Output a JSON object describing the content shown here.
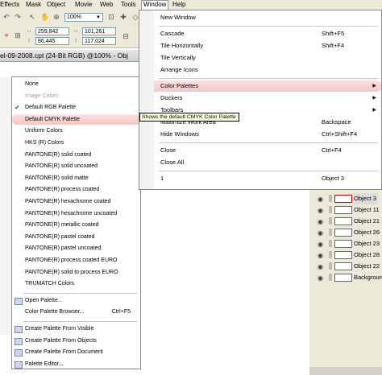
{
  "menubar": {
    "items": [
      "Effects",
      "Mask",
      "Object",
      "Movie",
      "Web",
      "Tools",
      "Window",
      "Help"
    ]
  },
  "toolbar": {
    "zoom": "100%",
    "x": "259,842",
    "y": "86,445",
    "w": "101,261",
    "h": "117,024"
  },
  "document": {
    "title": "el-09-2008.cpt (24-Bit RGB) @100% - Obj"
  },
  "window_menu": {
    "items": [
      {
        "label": "New Window",
        "shortcut": "",
        "icon": "new-window-icon"
      },
      {
        "separator": true
      },
      {
        "label": "Cascade",
        "shortcut": "Shift+F5",
        "icon": "cascade-icon"
      },
      {
        "label": "Tile Horizontally",
        "shortcut": "Shift+F4",
        "icon": "tile-horizontal-icon"
      },
      {
        "label": "Tile Vertically",
        "shortcut": "",
        "icon": "tile-vertical-icon"
      },
      {
        "label": "Arrange Icons",
        "shortcut": "",
        "icon": "arrange-icons-icon"
      },
      {
        "separator": true
      },
      {
        "label": "Color Palettes",
        "shortcut": "",
        "submenu": true,
        "highlighted": true
      },
      {
        "label": "Dockers",
        "shortcut": "",
        "submenu": true
      },
      {
        "label": "Toolbars",
        "shortcut": "",
        "submenu": true
      },
      {
        "label": "Maximize Work Area",
        "shortcut": "Backspace",
        "icon": "maximize-icon"
      },
      {
        "label": "Hide Windows",
        "shortcut": "Ctrl+Shift+F4",
        "icon": "hide-windows-icon"
      },
      {
        "separator": true
      },
      {
        "label": "Close",
        "shortcut": "Ctrl+F4",
        "icon": "close-window-icon"
      },
      {
        "label": "Close All",
        "shortcut": ""
      },
      {
        "separator": true
      },
      {
        "label": "1",
        "shortcut": "Object 3",
        "checked": true
      }
    ]
  },
  "palette_menu": {
    "items": [
      {
        "label": "None"
      },
      {
        "label": "Image Colors",
        "disabled": true
      },
      {
        "label": "Default RGB Palette",
        "checked": true
      },
      {
        "label": "Default CMYK Palette",
        "highlighted": true
      },
      {
        "label": "Uniform Colors"
      },
      {
        "label": "HKS (R) Colors"
      },
      {
        "label": "PANTONE(R) solid coated"
      },
      {
        "label": "PANTONE(R) solid uncoated"
      },
      {
        "label": "PANTONE(R) solid matte"
      },
      {
        "label": "PANTONE(R) process coated"
      },
      {
        "label": "PANTONE(R) hexachrome coated"
      },
      {
        "label": "PANTONE(R) hexachrome uncoated"
      },
      {
        "label": "PANTONE(R) metallic coated"
      },
      {
        "label": "PANTONE(R) pastel coated"
      },
      {
        "label": "PANTONE(R) pastel uncoated"
      },
      {
        "label": "PANTONE(R) process coated EURO"
      },
      {
        "label": "PANTONE(R) solid to process EURO"
      },
      {
        "label": "TRUMATCH Colors"
      },
      {
        "separator": true
      },
      {
        "label": "Open Palette...",
        "icon": "open-palette-icon"
      },
      {
        "label": "Color Palette Browser...",
        "shortcut": "Ctrl+F5"
      },
      {
        "separator": true
      },
      {
        "label": "Create Palette From Visible",
        "icon": "create-palette-icon"
      },
      {
        "label": "Create Palette From Objects",
        "icon": "create-palette-icon"
      },
      {
        "label": "Create Palette From Document",
        "icon": "create-palette-icon"
      },
      {
        "label": "Palette Editor...",
        "icon": "palette-editor-icon"
      }
    ]
  },
  "tooltip": "Shows the default CMYK Color Palette",
  "object_manager": {
    "objects": [
      {
        "label": "Object 3",
        "selected": true
      },
      {
        "label": "Object 11"
      },
      {
        "label": "Object 21"
      },
      {
        "label": "Object 26"
      },
      {
        "label": "Object 23"
      },
      {
        "label": "Object 28"
      },
      {
        "label": "Object 22"
      },
      {
        "label": "Background"
      }
    ]
  },
  "colors": {
    "highlight": "#f4c6c6",
    "menu_bg": "#ffffff",
    "chrome": "#ece9d8",
    "tooltip_bg": "#ffffe1"
  }
}
